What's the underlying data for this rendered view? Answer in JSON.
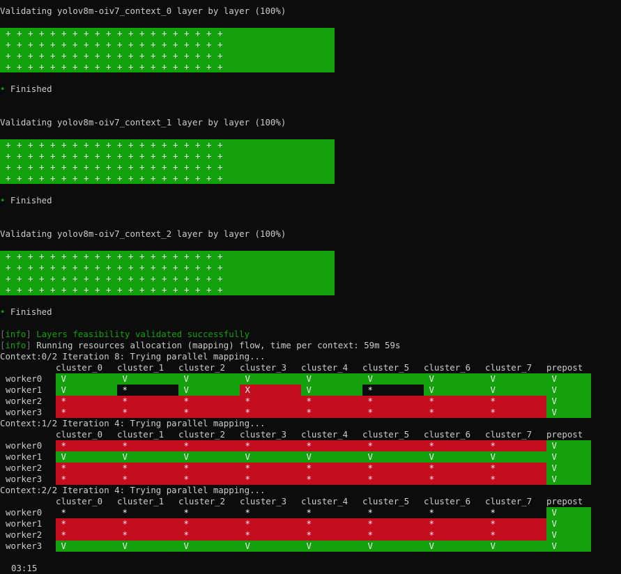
{
  "validations": [
    {
      "title": "Validating yolov8m-oiv7_context_0 layer by layer (100%)",
      "status": "Finished"
    },
    {
      "title": "Validating yolov8m-oiv7_context_1 layer by layer (100%)",
      "status": "Finished"
    },
    {
      "title": "Validating yolov8m-oiv7_context_2 layer by layer (100%)",
      "status": "Finished"
    }
  ],
  "plus_glyph": "+",
  "bullet": "•",
  "info": {
    "tag": "info",
    "line1": "Layers feasibility validated successfully",
    "line2": "Running resources allocation (mapping) flow, time per context: 59m 59s"
  },
  "clusters": [
    "cluster_0",
    "cluster_1",
    "cluster_2",
    "cluster_3",
    "cluster_4",
    "cluster_5",
    "cluster_6",
    "cluster_7",
    "prepost"
  ],
  "contexts": [
    {
      "title": "Context:0/2 Iteration 8: Trying parallel mapping...",
      "rows": [
        {
          "worker": "worker0",
          "cells": [
            [
              "V",
              "g"
            ],
            [
              "V",
              "g"
            ],
            [
              "V",
              "g"
            ],
            [
              "V",
              "g"
            ],
            [
              "V",
              "g"
            ],
            [
              "V",
              "g"
            ],
            [
              "V",
              "g"
            ],
            [
              "V",
              "g"
            ],
            [
              "V",
              "g"
            ]
          ]
        },
        {
          "worker": "worker1",
          "cells": [
            [
              "V",
              "g"
            ],
            [
              "*",
              "k"
            ],
            [
              "V",
              "g"
            ],
            [
              "X",
              "r"
            ],
            [
              "V",
              "g"
            ],
            [
              "*",
              "k"
            ],
            [
              "V",
              "g"
            ],
            [
              "V",
              "g"
            ],
            [
              "V",
              "g"
            ]
          ]
        },
        {
          "worker": "worker2",
          "cells": [
            [
              "*",
              "r"
            ],
            [
              "*",
              "r"
            ],
            [
              "*",
              "r"
            ],
            [
              "*",
              "r"
            ],
            [
              "*",
              "r"
            ],
            [
              "*",
              "r"
            ],
            [
              "*",
              "r"
            ],
            [
              "*",
              "r"
            ],
            [
              "V",
              "g"
            ]
          ]
        },
        {
          "worker": "worker3",
          "cells": [
            [
              "*",
              "r"
            ],
            [
              "*",
              "r"
            ],
            [
              "*",
              "r"
            ],
            [
              "*",
              "r"
            ],
            [
              "*",
              "r"
            ],
            [
              "*",
              "r"
            ],
            [
              "*",
              "r"
            ],
            [
              "*",
              "r"
            ],
            [
              "V",
              "g"
            ]
          ]
        }
      ]
    },
    {
      "title": "Context:1/2 Iteration 4: Trying parallel mapping...",
      "rows": [
        {
          "worker": "worker0",
          "cells": [
            [
              "*",
              "r"
            ],
            [
              "*",
              "r"
            ],
            [
              "*",
              "r"
            ],
            [
              "*",
              "r"
            ],
            [
              "*",
              "r"
            ],
            [
              "*",
              "r"
            ],
            [
              "*",
              "r"
            ],
            [
              "*",
              "r"
            ],
            [
              "V",
              "g"
            ]
          ]
        },
        {
          "worker": "worker1",
          "cells": [
            [
              "V",
              "g"
            ],
            [
              "V",
              "g"
            ],
            [
              "V",
              "g"
            ],
            [
              "V",
              "g"
            ],
            [
              "V",
              "g"
            ],
            [
              "V",
              "g"
            ],
            [
              "V",
              "g"
            ],
            [
              "V",
              "g"
            ],
            [
              "V",
              "g"
            ]
          ]
        },
        {
          "worker": "worker2",
          "cells": [
            [
              "*",
              "r"
            ],
            [
              "*",
              "r"
            ],
            [
              "*",
              "r"
            ],
            [
              "*",
              "r"
            ],
            [
              "*",
              "r"
            ],
            [
              "*",
              "r"
            ],
            [
              "*",
              "r"
            ],
            [
              "*",
              "r"
            ],
            [
              "V",
              "g"
            ]
          ]
        },
        {
          "worker": "worker3",
          "cells": [
            [
              "*",
              "r"
            ],
            [
              "*",
              "r"
            ],
            [
              "*",
              "r"
            ],
            [
              "*",
              "r"
            ],
            [
              "*",
              "r"
            ],
            [
              "*",
              "r"
            ],
            [
              "*",
              "r"
            ],
            [
              "*",
              "r"
            ],
            [
              "V",
              "g"
            ]
          ]
        }
      ]
    },
    {
      "title": "Context:2/2 Iteration 4: Trying parallel mapping...",
      "rows": [
        {
          "worker": "worker0",
          "cells": [
            [
              "*",
              "n"
            ],
            [
              "*",
              "n"
            ],
            [
              "*",
              "n"
            ],
            [
              "*",
              "n"
            ],
            [
              "*",
              "n"
            ],
            [
              "*",
              "n"
            ],
            [
              "*",
              "n"
            ],
            [
              "*",
              "n"
            ],
            [
              "V",
              "g"
            ]
          ]
        },
        {
          "worker": "worker1",
          "cells": [
            [
              "*",
              "r"
            ],
            [
              "*",
              "r"
            ],
            [
              "*",
              "r"
            ],
            [
              "*",
              "r"
            ],
            [
              "*",
              "r"
            ],
            [
              "*",
              "r"
            ],
            [
              "*",
              "r"
            ],
            [
              "*",
              "r"
            ],
            [
              "V",
              "g"
            ]
          ]
        },
        {
          "worker": "worker2",
          "cells": [
            [
              "*",
              "r"
            ],
            [
              "*",
              "r"
            ],
            [
              "*",
              "r"
            ],
            [
              "*",
              "r"
            ],
            [
              "*",
              "r"
            ],
            [
              "*",
              "r"
            ],
            [
              "*",
              "r"
            ],
            [
              "*",
              "r"
            ],
            [
              "V",
              "g"
            ]
          ]
        },
        {
          "worker": "worker3",
          "cells": [
            [
              "V",
              "g"
            ],
            [
              "V",
              "g"
            ],
            [
              "V",
              "g"
            ],
            [
              "V",
              "g"
            ],
            [
              "V",
              "g"
            ],
            [
              "V",
              "g"
            ],
            [
              "V",
              "g"
            ],
            [
              "V",
              "g"
            ],
            [
              "V",
              "g"
            ]
          ]
        }
      ]
    }
  ],
  "timer": "03:15",
  "colors": {
    "green": "#13a10e",
    "red": "#c50f1f",
    "background": "#0c0c0c",
    "text": "#cccccc"
  }
}
